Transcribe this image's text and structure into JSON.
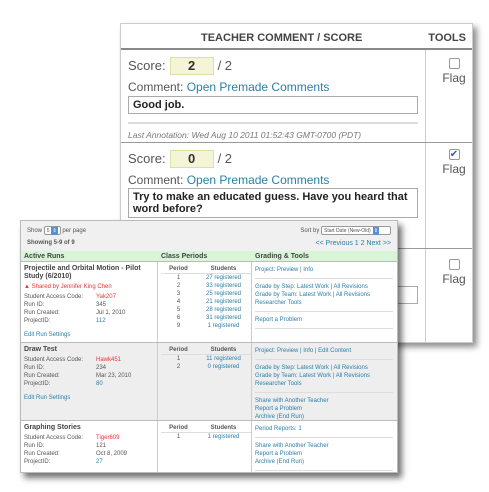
{
  "grading": {
    "header_comment": "TEACHER COMMENT / SCORE",
    "header_tools": "TOOLS",
    "rows": [
      {
        "score_label": "Score:",
        "score": "2",
        "max": "/ 2",
        "comment_label": "Comment:",
        "premade": "Open Premade Comments",
        "comment": "Good job.",
        "last": "Last Annotation: Wed Aug 10 2011 01:52:43 GMT-0700 (PDT)",
        "flag": "Flag",
        "flagged": false
      },
      {
        "score_label": "Score:",
        "score": "0",
        "max": "/ 2",
        "comment_label": "Comment:",
        "premade": "Open Premade Comments",
        "comment": "Try to make an educated guess.  Have you heard that word before?",
        "flag": "Flag",
        "flagged": true
      },
      {
        "flag": "Flag",
        "flagged": false
      }
    ]
  },
  "runs": {
    "show": "Show",
    "per_page_value": "5",
    "per_page": "per page",
    "showing": "Showing 5-9 of 9",
    "sort_by": "Sort by",
    "sort_value": "Start Date (New-Old)",
    "pager": "<< Previous 1 2 Next >>",
    "col_runs": "Active Runs",
    "col_periods": "Class Periods",
    "col_tools": "Grading & Tools",
    "period_h": "Period",
    "students_h": "Students",
    "items": [
      {
        "title": "Projectile and Orbital Motion - Pilot Study (6/2010)",
        "shared": "Shared by Jennifer King Chen",
        "k1": "Student Access Code:",
        "code": "Yak207",
        "k2": "Run ID:",
        "run_id": "345",
        "k3": "Run Created:",
        "created": "Jul 1, 2010",
        "k4": "ProjectID:",
        "project_id": "112",
        "edit": "Edit Run Settings",
        "periods": [
          [
            "1",
            "27 registered"
          ],
          [
            "2",
            "33 registered"
          ],
          [
            "3",
            "25 registered"
          ],
          [
            "4",
            "21 registered"
          ],
          [
            "5",
            "28 registered"
          ],
          [
            "6",
            "31 registered"
          ],
          [
            "9",
            "1 registered"
          ]
        ],
        "tools": [
          [
            "Project: Preview | Info"
          ],
          [
            "Grade by Step: Latest Work | All Revisions",
            "Grade by Team: Latest Work | All Revisions",
            "Researcher Tools"
          ],
          [
            "Report a Problem"
          ]
        ]
      },
      {
        "title": "Draw Test",
        "k1": "Student Access Code:",
        "code": "Hawk451",
        "k2": "Run ID:",
        "run_id": "234",
        "k3": "Run Created:",
        "created": "Mar 23, 2010",
        "k4": "ProjectID:",
        "project_id": "80",
        "edit": "Edit Run Settings",
        "periods": [
          [
            "1",
            "11 registered"
          ],
          [
            "2",
            "0 registered"
          ]
        ],
        "tools": [
          [
            "Project: Preview | Info | Edit Content"
          ],
          [
            "Grade by Step: Latest Work | All Revisions",
            "Grade by Team: Latest Work | All Revisions",
            "Researcher Tools"
          ],
          [
            "Share with Another Teacher",
            "Report a Problem",
            "Archive (End Run)"
          ]
        ]
      },
      {
        "title": "Graphing Stories",
        "k1": "Student Access Code:",
        "code": "Tiger609",
        "k2": "Run ID:",
        "run_id": "121",
        "k3": "Run Created:",
        "created": "Oct 8, 2009",
        "k4": "ProjectID:",
        "project_id": "27",
        "periods": [
          [
            "1",
            "1 registered"
          ]
        ],
        "tools": [
          [
            "Period Reports: 1"
          ],
          [
            "Share with Another Teacher",
            "Report a Problem",
            "Archive (End Run)"
          ]
        ]
      }
    ]
  }
}
